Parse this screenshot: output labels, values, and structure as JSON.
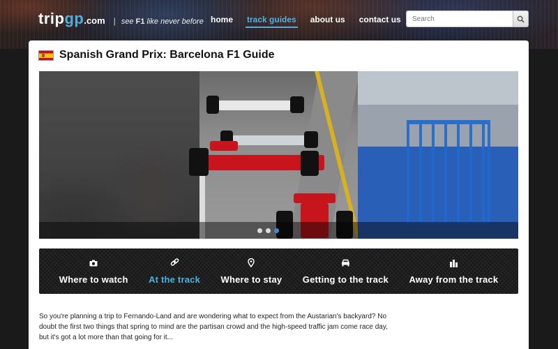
{
  "header": {
    "logo_main_1": "trip",
    "logo_main_2": "gp",
    "logo_domain": ".com",
    "logo_separator": "|",
    "tagline_prefix": "see ",
    "tagline_bold": "F1",
    "tagline_suffix": " like never before",
    "nav": [
      {
        "label": "home",
        "active": false
      },
      {
        "label": "track guides",
        "active": true
      },
      {
        "label": "about us",
        "active": false
      },
      {
        "label": "contact us",
        "active": false
      }
    ],
    "search_placeholder": "Search"
  },
  "page": {
    "title": "Spanish Grand Prix: Barcelona F1 Guide",
    "flag": "spain-flag"
  },
  "slider": {
    "dots": [
      false,
      false,
      true
    ]
  },
  "guide_sections": [
    {
      "label": "Where to watch",
      "icon": "camera-icon",
      "active": false
    },
    {
      "label": "At the track",
      "icon": "link-icon",
      "active": true
    },
    {
      "label": "Where to stay",
      "icon": "location-pin-icon",
      "active": false
    },
    {
      "label": "Getting to the track",
      "icon": "car-icon",
      "active": false
    },
    {
      "label": "Away from the track",
      "icon": "city-icon",
      "active": false
    }
  ],
  "intro_text": "So you're planning a trip to Fernando-Land and are wondering what to expect from the Austarian's backyard? No doubt the first two things that spring to mind are the partisan crowd and the high-speed traffic jam come race day, but it's got a lot more than that going for it...",
  "colors": {
    "accent": "#4db0e0",
    "guide_bar": "#1e1e1e"
  }
}
